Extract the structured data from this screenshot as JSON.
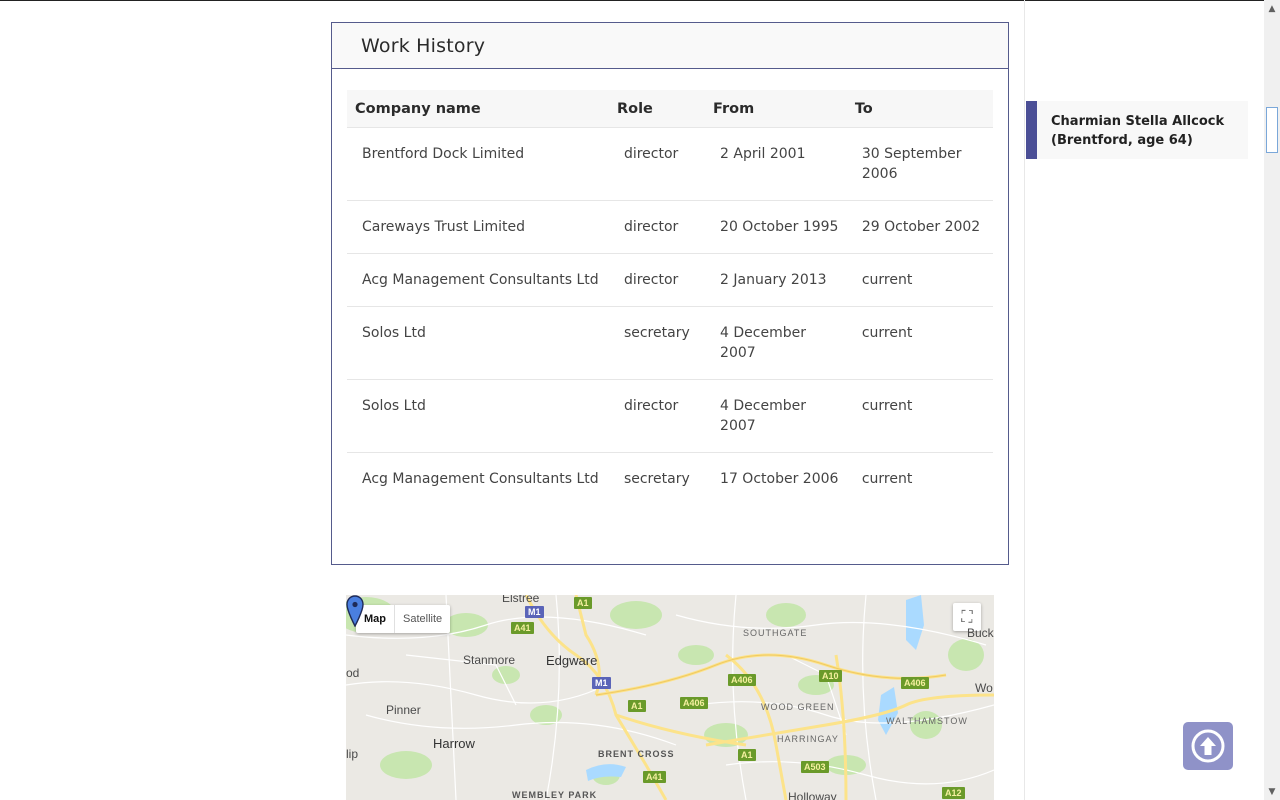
{
  "work_history": {
    "title": "Work History",
    "columns": [
      "Company name",
      "Role",
      "From",
      "To"
    ],
    "rows": [
      {
        "company": "Brentford Dock Limited",
        "role": "director",
        "from": "2 April 2001",
        "to": "30 September 2006"
      },
      {
        "company": "Careways Trust Limited",
        "role": "director",
        "from": "20 October 1995",
        "to": "29 October 2002"
      },
      {
        "company": "Acg Management Consultants Ltd",
        "role": "director",
        "from": "2 January 2013",
        "to": "current"
      },
      {
        "company": "Solos Ltd",
        "role": "secretary",
        "from": "4 December 2007",
        "to": "current"
      },
      {
        "company": "Solos Ltd",
        "role": "director",
        "from": "4 December 2007",
        "to": "current"
      },
      {
        "company": "Acg Management Consultants Ltd",
        "role": "secretary",
        "from": "17 October 2006",
        "to": "current"
      }
    ]
  },
  "sidebar": {
    "person_label": "Charmian Stella Allcock (Brentford, age 64)"
  },
  "map": {
    "type_buttons": {
      "map": "Map",
      "satellite": "Satellite"
    },
    "places": {
      "elstree": "Elstree",
      "edgware": "Edgware",
      "stanmore": "Stanmore",
      "pinner": "Pinner",
      "harrow": "Harrow",
      "southgate": "SOUTHGATE",
      "wood_green": "WOOD GREEN",
      "walthamstow": "WALTHAMSTOW",
      "harringay": "HARRINGAY",
      "brent_cross": "BRENT CROSS",
      "wembley_park": "WEMBLEY PARK",
      "holloway": "Holloway",
      "buck": "Buck",
      "wo": "Wo",
      "od": "od",
      "lip": "lip"
    },
    "roads": {
      "m1a": "M1",
      "m1b": "M1",
      "a1a": "A1",
      "a1b": "A1",
      "a1c": "A1",
      "a41a": "A41",
      "a41b": "A41",
      "a406a": "A406",
      "a406b": "A406",
      "a406c": "A406",
      "a10": "A10",
      "a503": "A503",
      "a12": "A12"
    },
    "accent_water": "#aadaff",
    "accent_green": "#c8e6b0",
    "accent_road": "#fce38a"
  },
  "colors": {
    "accent": "#4b4f96",
    "card_border": "#555b8c",
    "back_to_top": "#8f92c8"
  }
}
